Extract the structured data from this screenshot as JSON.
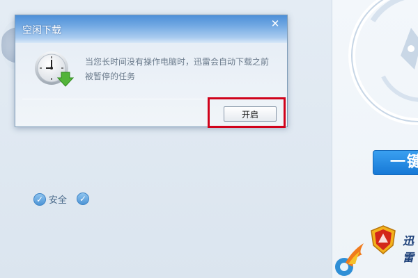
{
  "dialog": {
    "title": "空闲下载",
    "close_glyph": "✕",
    "message": "当您长时间没有操作电脑时，迅雷会自动下载之前被暂停的任务",
    "enable_label": "开启",
    "icon": "clock-download-icon"
  },
  "background": {
    "onekey_label": "一键",
    "safety_label": "安全",
    "brand_text": "迅雷",
    "accent_color": "#1678d6",
    "highlight_color": "#d0021b"
  }
}
